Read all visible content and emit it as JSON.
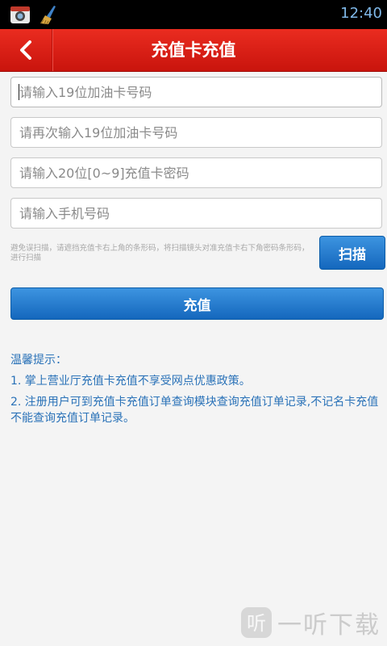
{
  "status_bar": {
    "time": "12:40",
    "icons": [
      "camera-app-icon",
      "broom-cleaner-icon"
    ]
  },
  "header": {
    "title": "充值卡充值",
    "back_icon": "chevron-left-icon"
  },
  "form": {
    "card_number_placeholder": "请输入19位加油卡号码",
    "card_number_confirm_placeholder": "请再次输入19位加油卡号码",
    "card_password_placeholder": "请输入20位[0~9]充值卡密码",
    "phone_placeholder": "请输入手机号码",
    "scan_hint": "避免误扫描，请遮挡充值卡右上角的条形码，将扫描镜头对准充值卡右下角密码条形码，进行扫描",
    "scan_label": "扫描",
    "submit_label": "充值"
  },
  "tips": {
    "title": "温馨提示：",
    "items": [
      "1. 掌上营业厅充值卡充值不享受网点优惠政策。",
      "2. 注册用户可到充值卡充值订单查询模块查询充值订单记录,不记名卡充值不能查询充值订单记录。"
    ]
  },
  "watermark": {
    "logo_glyph": "听",
    "text": "一听下载"
  },
  "colors": {
    "header_red": "#d81e14",
    "button_blue": "#1f74c9",
    "tip_blue": "#2a72b8"
  }
}
